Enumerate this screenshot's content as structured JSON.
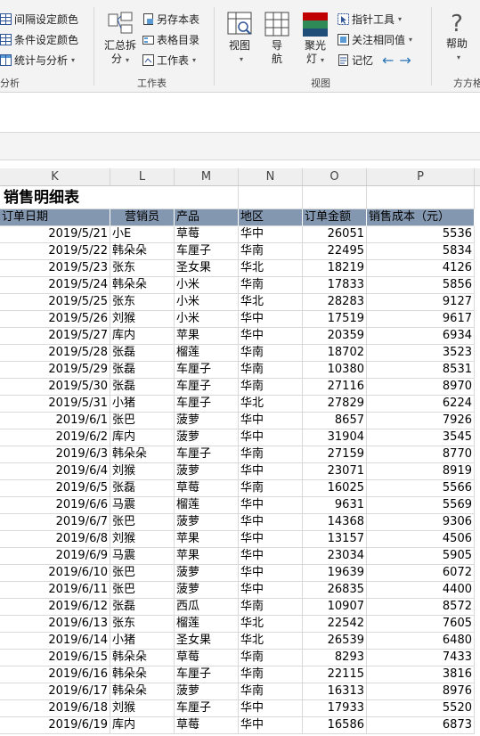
{
  "ribbon": {
    "group_analysis": {
      "items": [
        "间隔设定颜色",
        "条件设定颜色",
        "统计与分析"
      ],
      "label": "分析"
    },
    "group_worksheet": {
      "summary_split": [
        "汇总拆",
        "分"
      ],
      "items": [
        "另存本表",
        "表格目录",
        "工作表"
      ],
      "label": "工作表"
    },
    "group_view": {
      "view": "视图",
      "nav": [
        "导",
        "航"
      ],
      "spotlight": [
        "聚光",
        "灯"
      ],
      "items": [
        "指针工具",
        "关注相同值",
        "记忆"
      ],
      "label": "视图"
    },
    "group_help": {
      "help": "帮助",
      "label": "方方格"
    }
  },
  "columns": [
    "K",
    "L",
    "M",
    "N",
    "O",
    "P"
  ],
  "sheet": {
    "title": "销售明细表",
    "headers": [
      "订单日期",
      "营销员",
      "产品",
      "地区",
      "订单金额",
      "销售成本（元）"
    ],
    "rows": [
      [
        "2019/5/21",
        "小E",
        "草莓",
        "华中",
        "26051",
        "5536"
      ],
      [
        "2019/5/22",
        "韩朵朵",
        "车厘子",
        "华南",
        "22495",
        "5834"
      ],
      [
        "2019/5/23",
        "张东",
        "圣女果",
        "华北",
        "18219",
        "4126"
      ],
      [
        "2019/5/24",
        "韩朵朵",
        "小米",
        "华南",
        "17833",
        "5856"
      ],
      [
        "2019/5/25",
        "张东",
        "小米",
        "华北",
        "28283",
        "9127"
      ],
      [
        "2019/5/26",
        "刘猴",
        "小米",
        "华中",
        "17519",
        "9617"
      ],
      [
        "2019/5/27",
        "库内",
        "苹果",
        "华中",
        "20359",
        "6934"
      ],
      [
        "2019/5/28",
        "张磊",
        "榴莲",
        "华南",
        "18702",
        "3523"
      ],
      [
        "2019/5/29",
        "张磊",
        "车厘子",
        "华南",
        "10380",
        "8531"
      ],
      [
        "2019/5/30",
        "张磊",
        "车厘子",
        "华南",
        "27116",
        "8970"
      ],
      [
        "2019/5/31",
        "小猪",
        "车厘子",
        "华北",
        "27829",
        "6224"
      ],
      [
        "2019/6/1",
        "张巴",
        "菠萝",
        "华中",
        "8657",
        "7926"
      ],
      [
        "2019/6/2",
        "库内",
        "菠萝",
        "华中",
        "31904",
        "3545"
      ],
      [
        "2019/6/3",
        "韩朵朵",
        "车厘子",
        "华南",
        "27159",
        "8770"
      ],
      [
        "2019/6/4",
        "刘猴",
        "菠萝",
        "华中",
        "23071",
        "8919"
      ],
      [
        "2019/6/5",
        "张磊",
        "草莓",
        "华南",
        "16025",
        "5566"
      ],
      [
        "2019/6/6",
        "马震",
        "榴莲",
        "华中",
        "9631",
        "5569"
      ],
      [
        "2019/6/7",
        "张巴",
        "菠萝",
        "华中",
        "14368",
        "9306"
      ],
      [
        "2019/6/8",
        "刘猴",
        "苹果",
        "华中",
        "13157",
        "4506"
      ],
      [
        "2019/6/9",
        "马震",
        "苹果",
        "华中",
        "23034",
        "5905"
      ],
      [
        "2019/6/10",
        "张巴",
        "菠萝",
        "华中",
        "19639",
        "6072"
      ],
      [
        "2019/6/11",
        "张巴",
        "菠萝",
        "华中",
        "26835",
        "4400"
      ],
      [
        "2019/6/12",
        "张磊",
        "西瓜",
        "华南",
        "10907",
        "8572"
      ],
      [
        "2019/6/13",
        "张东",
        "榴莲",
        "华北",
        "22542",
        "7605"
      ],
      [
        "2019/6/14",
        "小猪",
        "圣女果",
        "华北",
        "26539",
        "6480"
      ],
      [
        "2019/6/15",
        "韩朵朵",
        "草莓",
        "华南",
        "8293",
        "7433"
      ],
      [
        "2019/6/16",
        "韩朵朵",
        "车厘子",
        "华南",
        "22115",
        "3816"
      ],
      [
        "2019/6/17",
        "韩朵朵",
        "菠萝",
        "华南",
        "16313",
        "8976"
      ],
      [
        "2019/6/18",
        "刘猴",
        "车厘子",
        "华中",
        "17933",
        "5520"
      ],
      [
        "2019/6/19",
        "库内",
        "草莓",
        "华中",
        "16586",
        "6873"
      ]
    ]
  },
  "colors": {
    "header_fill": "#8497b0",
    "ribbon_bg": "#f3f3f3"
  }
}
